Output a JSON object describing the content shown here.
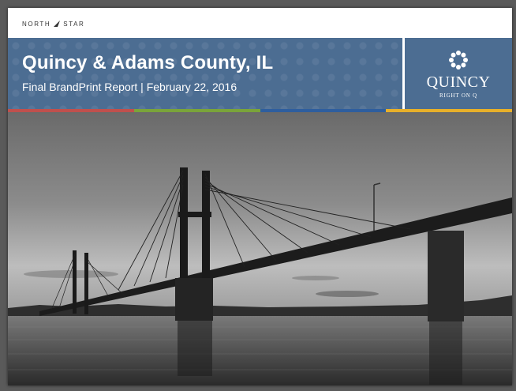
{
  "header": {
    "logo_left": "NORTH",
    "logo_right": "STAR"
  },
  "banner": {
    "title": "Quincy & Adams County, IL",
    "subtitle": "Final BrandPrint Report | February 22, 2016"
  },
  "brand": {
    "name": "QUINCY",
    "tagline": "RIGHT ON Q"
  },
  "colors": {
    "banner": "#4c6d92",
    "stripe": [
      "#c0504d",
      "#7aa43a",
      "#2e5e9e",
      "#e8b02a"
    ]
  },
  "icons": {
    "logo_mark": "north-star-arrow-icon",
    "brand_mark": "sunburst-q-icon"
  }
}
